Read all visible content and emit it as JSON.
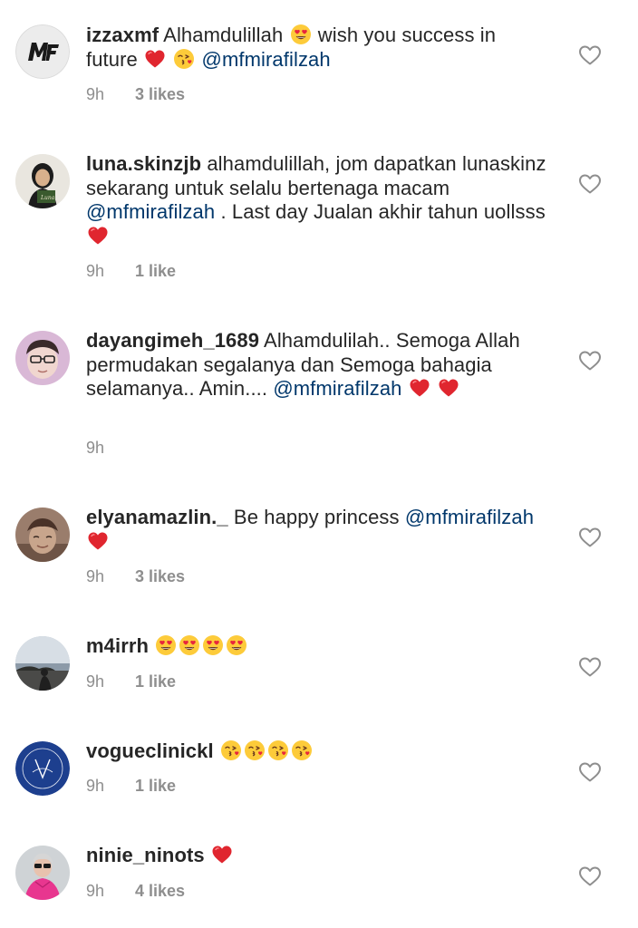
{
  "comments": [
    {
      "username": "izzaxmf",
      "avatar": "mf-logo-avatar",
      "segments": [
        "Alhamdulillah",
        "wish you success in future",
        "@mfmirafilzah"
      ],
      "time": "9h",
      "likes": "3 likes"
    },
    {
      "username": "luna.skinzjb",
      "avatar": "user-photo-avatar",
      "segments": [
        "alhamdulillah, jom dapatkan lunaskinz sekarang untuk selalu bertenaga macam",
        "@mfmirafilzah",
        ". Last day Jualan akhir tahun uollsss"
      ],
      "time": "9h",
      "likes": "1 like"
    },
    {
      "username": "dayangimeh_1689",
      "avatar": "user-photo-avatar",
      "segments": [
        "Alhamdulilah.. Semoga Allah permudakan segalanya dan Semoga bahagia selamanya.. Amin....",
        "@mfmirafilzah"
      ],
      "time": "9h",
      "likes": ""
    },
    {
      "username": "elyanamazlin._",
      "avatar": "user-photo-avatar",
      "segments": [
        "Be happy princess",
        "@mfmirafilzah"
      ],
      "time": "9h",
      "likes": "3 likes"
    },
    {
      "username": "m4irrh",
      "avatar": "user-photo-avatar",
      "segments": [],
      "time": "9h",
      "likes": "1 like"
    },
    {
      "username": "vogueclinickl",
      "avatar": "vogue-logo-avatar",
      "segments": [],
      "time": "9h",
      "likes": "1 like"
    },
    {
      "username": "ninie_ninots",
      "avatar": "user-photo-avatar",
      "segments": [],
      "time": "9h",
      "likes": "4 likes"
    }
  ],
  "icons": {
    "like": "heart-outline-icon",
    "heart_emoji": "red-heart-emoji",
    "heart_eyes_emoji": "heart-eyes-emoji",
    "kiss_emoji": "face-blowing-kiss-emoji"
  },
  "colors": {
    "text": "#262626",
    "mention": "#00376b",
    "meta": "#8e8e8e",
    "heart": "#ed4956"
  }
}
